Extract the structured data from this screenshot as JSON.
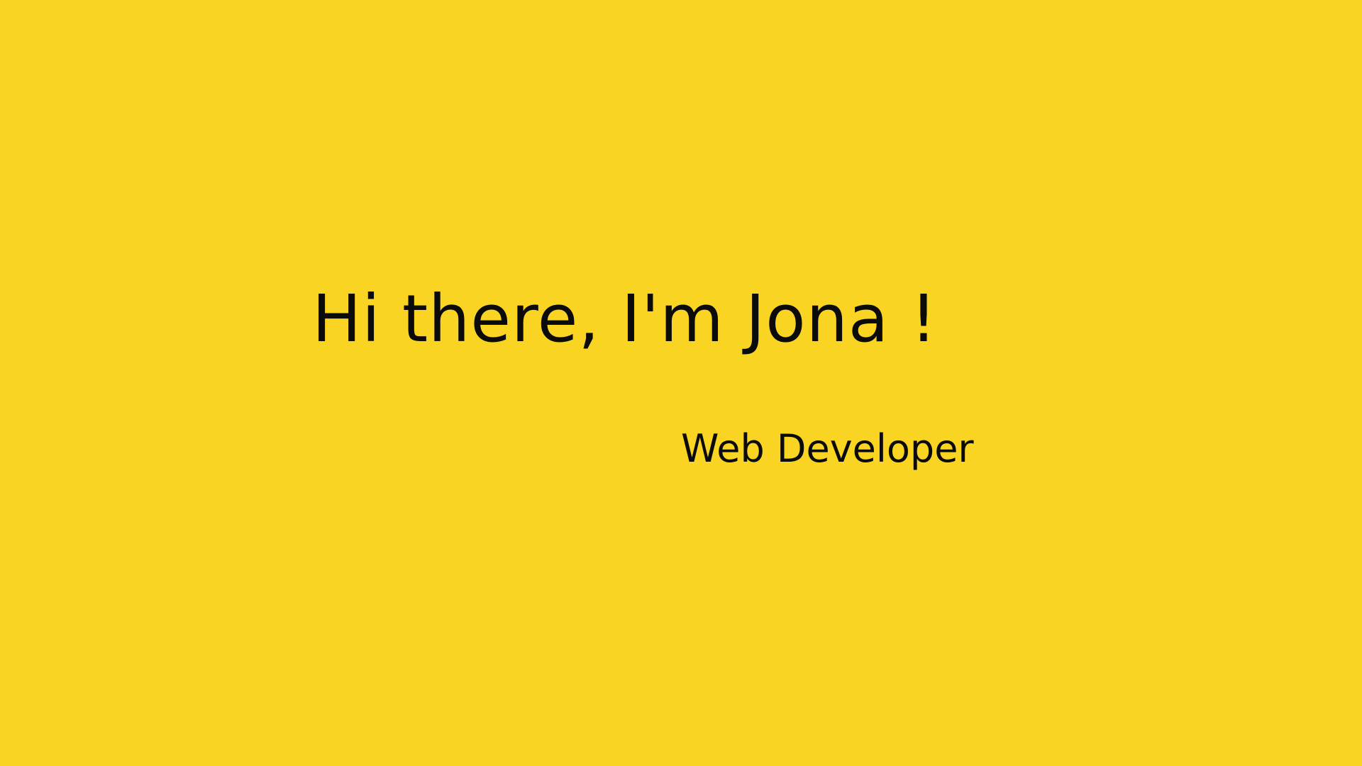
{
  "page": {
    "background_color": "#F9D423",
    "text_color": "#0b0b0b"
  },
  "hero": {
    "headline": "Hi there, I'm Jona !",
    "subtitle": "Web Developer"
  }
}
